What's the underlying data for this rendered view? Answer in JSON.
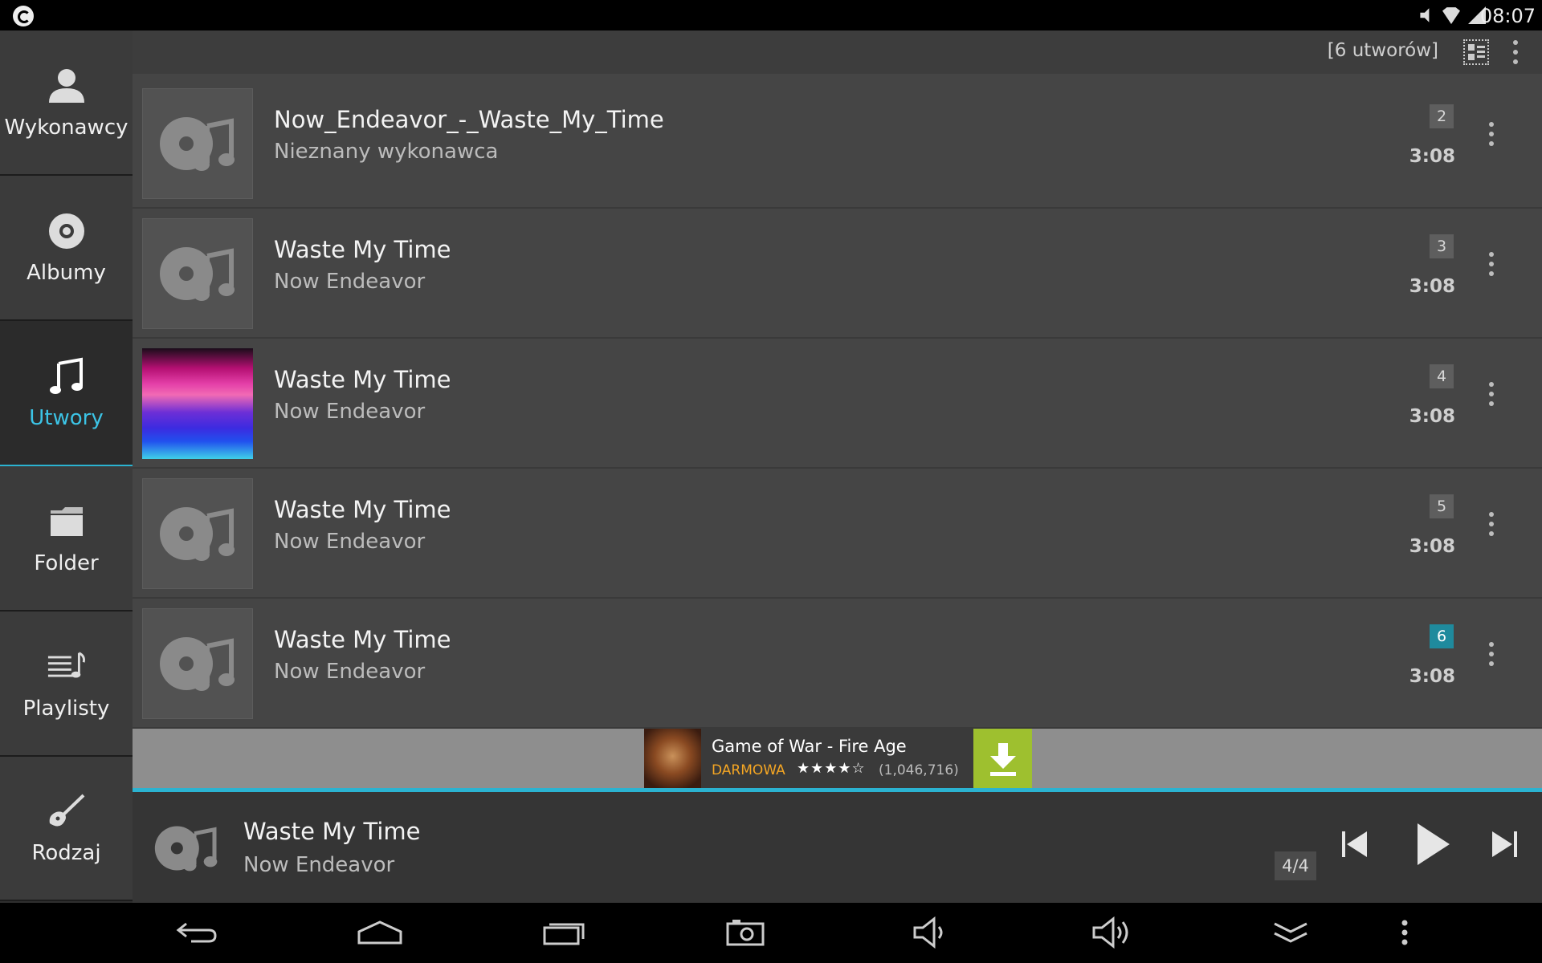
{
  "status_bar": {
    "time": "08:07",
    "icons": [
      "app-logo-icon",
      "mute-icon",
      "wifi-icon",
      "battery-icon"
    ]
  },
  "sidebar": {
    "items": [
      {
        "label": "Wykonawcy",
        "icon": "person-icon",
        "active": false
      },
      {
        "label": "Albumy",
        "icon": "disc-icon",
        "active": false
      },
      {
        "label": "Utwory",
        "icon": "music-note-icon",
        "active": true
      },
      {
        "label": "Folder",
        "icon": "folder-icon",
        "active": false
      },
      {
        "label": "Playlisty",
        "icon": "playlist-icon",
        "active": false
      },
      {
        "label": "Rodzaj",
        "icon": "guitar-icon",
        "active": false
      }
    ]
  },
  "toolbar": {
    "count_label": "[6 utworów]",
    "view_icon": "view-toggle-icon",
    "overflow_icon": "overflow-menu-icon"
  },
  "tracks": [
    {
      "title": "Now_Endeavor_-_Waste_My_Time",
      "artist": "Nieznany wykonawca",
      "number": "2",
      "duration": "3:08",
      "art": "default"
    },
    {
      "title": "Waste My Time",
      "artist": "Now Endeavor",
      "number": "3",
      "duration": "3:08",
      "art": "default"
    },
    {
      "title": "Waste My Time",
      "artist": "Now Endeavor",
      "number": "4",
      "duration": "3:08",
      "art": "album-art"
    },
    {
      "title": "Waste My Time",
      "artist": "Now Endeavor",
      "number": "5",
      "duration": "3:08",
      "art": "default"
    },
    {
      "title": "Waste My Time",
      "artist": "Now Endeavor",
      "number": "6",
      "duration": "3:08",
      "art": "default",
      "current": true
    }
  ],
  "ad": {
    "title": "Game of War - Fire Age",
    "price": "DARMOWA",
    "stars": "★★★★☆",
    "rating_count": "(1,046,716)",
    "rating": 4.5
  },
  "now_playing": {
    "title": "Waste My Time",
    "artist": "Now Endeavor",
    "position": "4/4"
  },
  "colors": {
    "accent": "#2bb3d1",
    "active_label": "#3cc4e6",
    "current_badge": "#1f8a9d",
    "ad_price": "#f5a623",
    "ad_download": "#9ec02f"
  },
  "navbar": [
    "back-icon",
    "home-icon",
    "recent-apps-icon",
    "screenshot-icon",
    "volume-down-icon",
    "volume-up-icon",
    "collapse-icon",
    "menu-icon"
  ]
}
